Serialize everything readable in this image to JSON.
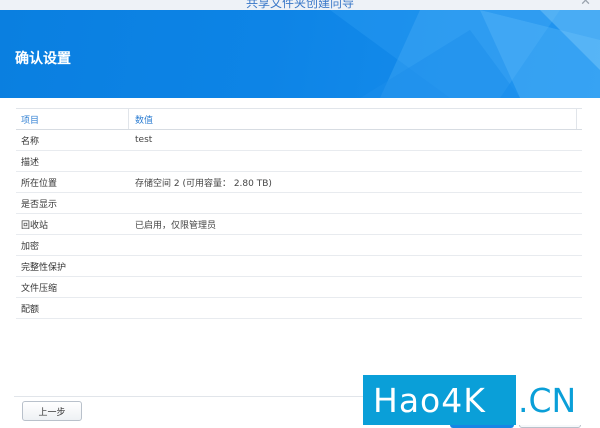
{
  "window": {
    "title": "共享文件夹创建向导"
  },
  "banner": {
    "heading": "确认设置"
  },
  "table": {
    "headers": [
      "项目",
      "数值"
    ],
    "rows": [
      {
        "item": "名称",
        "value": "test"
      },
      {
        "item": "描述",
        "value": ""
      },
      {
        "item": "所在位置",
        "value": "存储空间 2 (可用容量： 2.80 TB)"
      },
      {
        "item": "是否显示",
        "value": ""
      },
      {
        "item": "回收站",
        "value": "已启用，仅限管理员"
      },
      {
        "item": "加密",
        "value": ""
      },
      {
        "item": "完整性保护",
        "value": ""
      },
      {
        "item": "文件压缩",
        "value": ""
      },
      {
        "item": "配额",
        "value": ""
      }
    ]
  },
  "footer": {
    "prev_label": "上一步"
  },
  "watermark": {
    "left": "Hao4K",
    "right": ".CN"
  },
  "colors": {
    "accent": "#0d84e6",
    "header_text": "#2f7fd3",
    "watermark": "#0a9fd8"
  }
}
